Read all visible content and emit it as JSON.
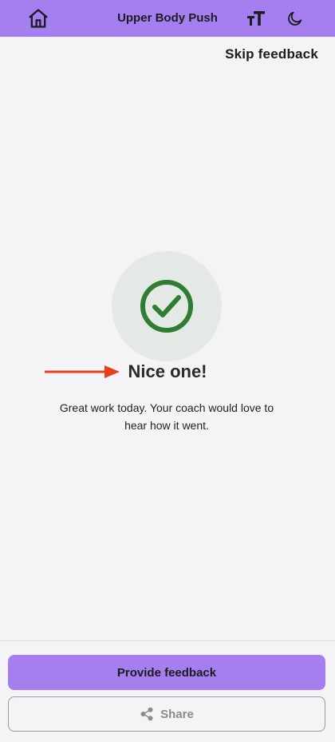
{
  "header": {
    "title": "Upper Body Push",
    "icons": {
      "home": "home-icon",
      "text_size": "text-size-icon",
      "dark_mode": "moon-icon"
    },
    "background_color": "#a57ff0"
  },
  "skip_label": "Skip feedback",
  "success": {
    "icon": "check-circle-icon",
    "icon_color": "#2e7d32",
    "headline": "Nice one!",
    "message": "Great work today. Your coach would love to hear how it went."
  },
  "annotation": {
    "arrow_color": "#e8401c"
  },
  "actions": {
    "primary_label": "Provide feedback",
    "secondary_label": "Share",
    "secondary_icon": "share-icon"
  }
}
